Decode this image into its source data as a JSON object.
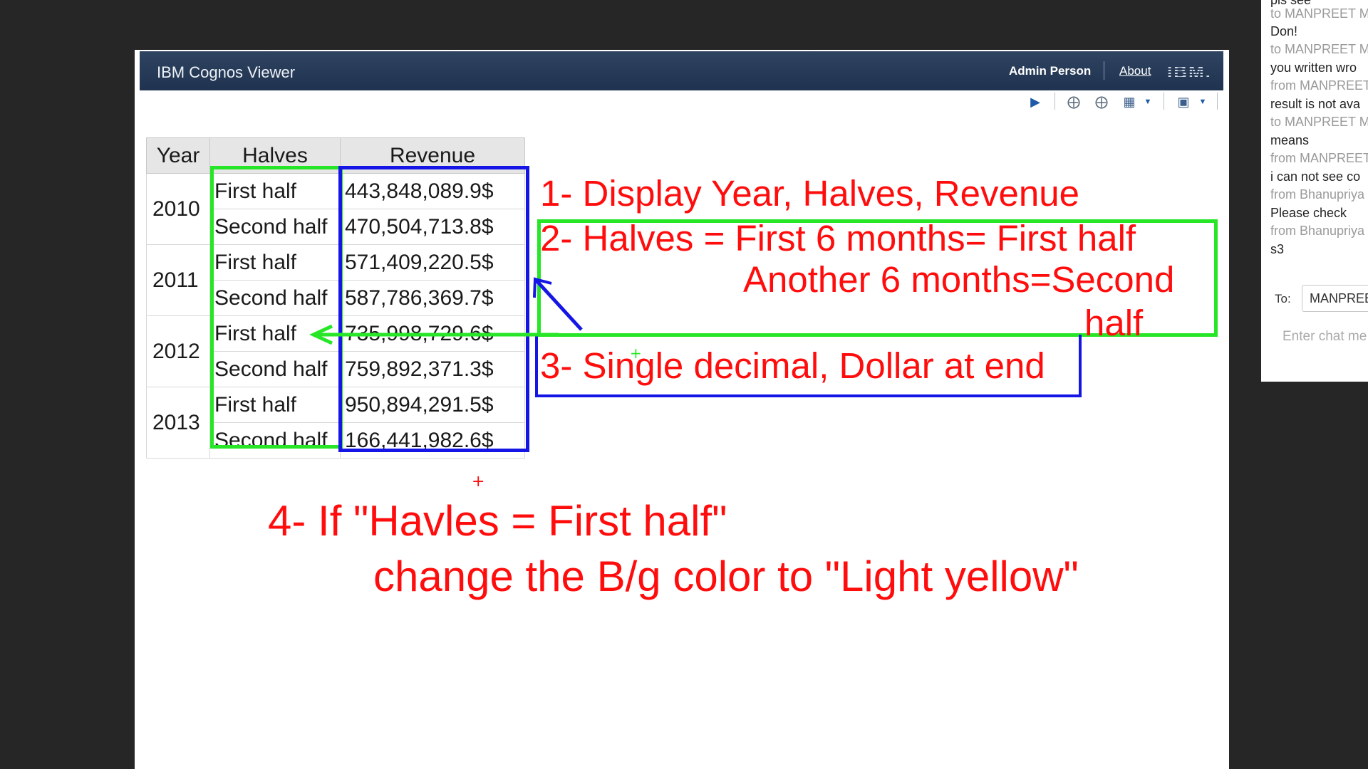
{
  "banner": {
    "title": "IBM Cognos Viewer",
    "user": "Admin Person",
    "about": "About",
    "logo": "IBM."
  },
  "toolbar": {
    "icons": [
      "run-icon",
      "drill-down-icon",
      "drill-up-icon",
      "go-to-icon",
      "keep-this-version-icon"
    ]
  },
  "report": {
    "headers": {
      "year": "Year",
      "halves": "Halves",
      "revenue": "Revenue"
    },
    "groups": [
      {
        "year": "2010",
        "rows": [
          {
            "half": "First half",
            "revenue": "443,848,089.9$"
          },
          {
            "half": "Second half",
            "revenue": "470,504,713.8$"
          }
        ]
      },
      {
        "year": "2011",
        "rows": [
          {
            "half": "First half",
            "revenue": "571,409,220.5$"
          },
          {
            "half": "Second half",
            "revenue": "587,786,369.7$"
          }
        ]
      },
      {
        "year": "2012",
        "rows": [
          {
            "half": "First half",
            "revenue": "735,998,729.6$"
          },
          {
            "half": "Second half",
            "revenue": "759,892,371.3$"
          }
        ]
      },
      {
        "year": "2013",
        "rows": [
          {
            "half": "First half",
            "revenue": "950,894,291.5$"
          },
          {
            "half": "Second half",
            "revenue": "166,441,982.6$"
          }
        ]
      }
    ]
  },
  "annotations": {
    "note1": "1- Display Year, Halves, Revenue",
    "note2_line1": "2- Halves = First 6 months= First half",
    "note2_line2": "Another 6 months=Second",
    "note2_line3": "half",
    "note3": "3- Single decimal, Dollar at end",
    "note4_line1": "4- If \"Havles = First half\"",
    "note4_line2": "change the B/g color to \"Light yellow\"",
    "colors": {
      "text": "#ff0d0d",
      "green_box": "#27e627",
      "blue_box": "#1515e6"
    }
  },
  "chat": {
    "lines": [
      {
        "kind": "msg",
        "text": "pls see"
      },
      {
        "kind": "meta",
        "text": "to MANPREET MA"
      },
      {
        "kind": "msg",
        "text": "Don!"
      },
      {
        "kind": "meta",
        "text": "to MANPREET MA"
      },
      {
        "kind": "msg",
        "text": "you written wro"
      },
      {
        "kind": "meta",
        "text": "from MANPREET"
      },
      {
        "kind": "msg",
        "text": "result is not ava"
      },
      {
        "kind": "meta",
        "text": "to MANPREET MA"
      },
      {
        "kind": "msg",
        "text": "means"
      },
      {
        "kind": "meta",
        "text": "from MANPREET"
      },
      {
        "kind": "msg",
        "text": "i can not see co"
      },
      {
        "kind": "meta",
        "text": "from Bhanupriya"
      },
      {
        "kind": "msg",
        "text": "Please check"
      },
      {
        "kind": "meta",
        "text": "from Bhanupriya"
      },
      {
        "kind": "msg",
        "text": "s3"
      }
    ],
    "to_label": "To:",
    "to_value": "MANPREE",
    "input_placeholder": "Enter chat me"
  }
}
